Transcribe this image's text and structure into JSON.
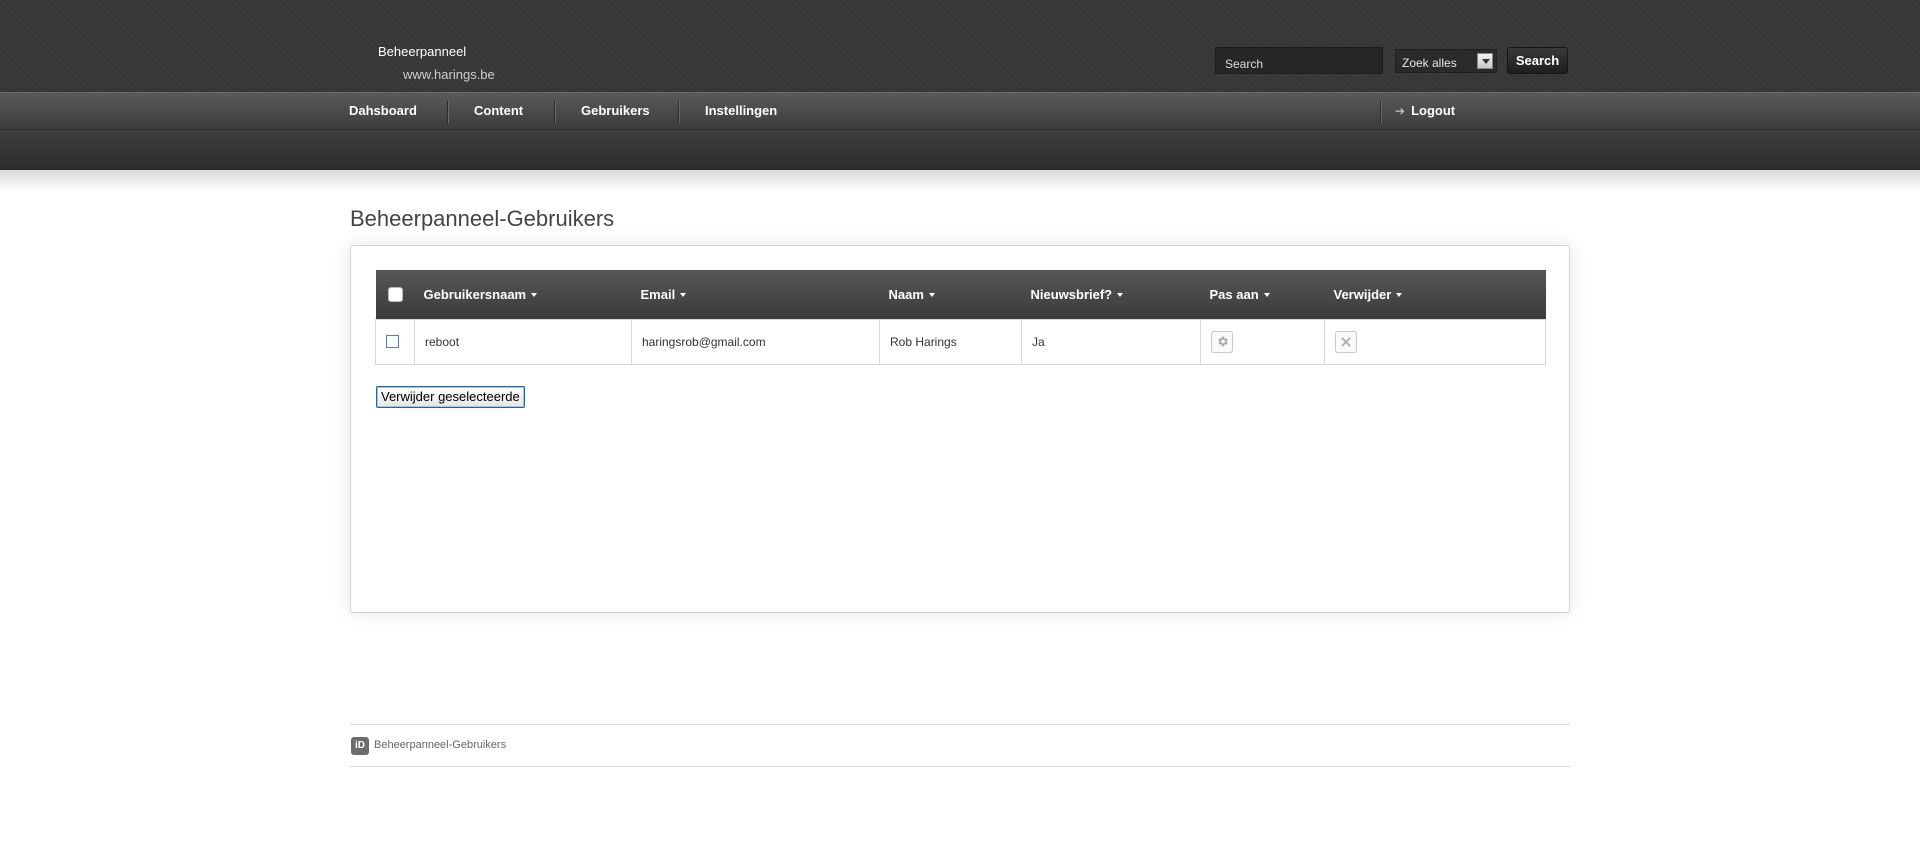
{
  "brand": {
    "title": "Beheerpanneel",
    "url": "www.harings.be"
  },
  "search": {
    "placeholder": "Search",
    "scope_selected": "Zoek alles",
    "button_label": "Search"
  },
  "nav": {
    "items": [
      {
        "label": "Dahsboard"
      },
      {
        "label": "Content"
      },
      {
        "label": "Gebruikers"
      },
      {
        "label": "Instellingen"
      }
    ],
    "logout_label": "Logout"
  },
  "page": {
    "title": "Beheerpanneel-Gebruikers"
  },
  "table": {
    "columns": [
      "Gebruikersnaam",
      "Email",
      "Naam",
      "Nieuwsbrief?",
      "Pas aan",
      "Verwijder"
    ],
    "rows": [
      {
        "username": "reboot",
        "email": "haringsrob@gmail.com",
        "name": "Rob Harings",
        "newsletter": "Ja",
        "edit_icon": "gear-icon",
        "delete_icon": "close-icon"
      }
    ]
  },
  "actions": {
    "delete_selected_label": "Verwijder geselecteerde"
  },
  "footer": {
    "text": "Beheerpanneel-Gebruikers",
    "icon": "id-logo-icon"
  }
}
